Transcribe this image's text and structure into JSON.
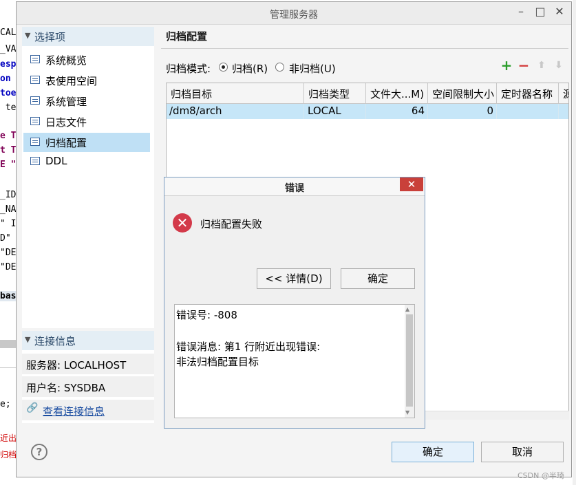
{
  "window": {
    "title": "管理服务器"
  },
  "background": {
    "lines": [
      "CAL",
      "_VA",
      "esp",
      "on",
      "toe",
      " te",
      "e T",
      "t T",
      "E \"",
      "_ID",
      "_NA",
      "\" I",
      "D\"",
      "\"DE",
      "\"DE",
      "bas",
      "e;",
      "近出",
      "归档"
    ]
  },
  "sidebar": {
    "section_title": "选择项",
    "items": [
      {
        "label": "系统概览"
      },
      {
        "label": "表使用空间"
      },
      {
        "label": "系统管理"
      },
      {
        "label": "日志文件"
      },
      {
        "label": "归档配置"
      },
      {
        "label": "DDL"
      }
    ]
  },
  "connection": {
    "section_title": "连接信息",
    "server": "服务器: LOCALHOST",
    "user": "用户名: SYSDBA",
    "link": "查看连接信息"
  },
  "main": {
    "title": "归档配置",
    "mode_label": "归档模式:",
    "mode_archive": "归档(R)",
    "mode_noarchive": "非归档(U)",
    "table": {
      "headers": [
        "归档目标",
        "归档类型",
        "文件大...M)",
        "空间限制大小",
        "定时器名称",
        "源"
      ],
      "rows": [
        {
          "target": "/dm8/arch",
          "type": "LOCAL",
          "file_size": "64",
          "space_limit": "0",
          "timer": ""
        }
      ]
    },
    "ok_label": "确定",
    "cancel_label": "取消"
  },
  "dialog": {
    "title": "错误",
    "close": "✕",
    "message": "归档配置失败",
    "details_button": "<< 详情(D)",
    "ok_button": "确定",
    "detail_lines": [
      "错误号: -808",
      "错误消息: 第1 行附近出现错误:",
      "非法归档配置目标"
    ]
  },
  "watermark": "CSDN @半琦",
  "colors": {
    "selection": "#bfe0f5",
    "add": "#2a9d2a",
    "remove": "#d33a3a",
    "error": "#d33a4a"
  }
}
